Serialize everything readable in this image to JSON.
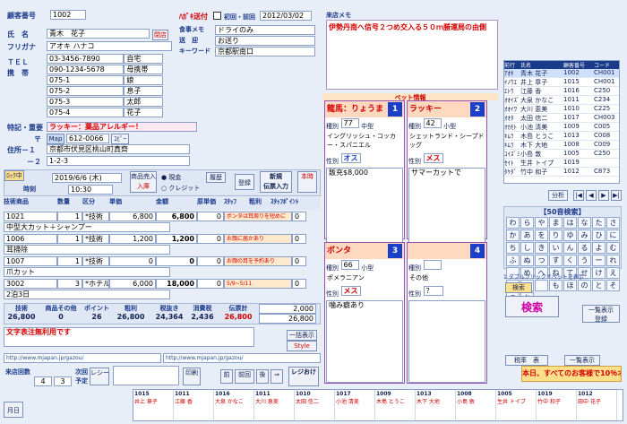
{
  "header": {
    "customer_no_label": "顧客番号",
    "customer_no": "1002",
    "postcard_label": "ﾊｶﾞｷ送付",
    "first_visit_label": "初回・前回",
    "first_visit": "2012/03/02",
    "memo_label": "来店メモ",
    "memo_text": "伊勢丹南へ信号２つめ交入る５０ｍ勝運局の由側"
  },
  "customer": {
    "name_label": "氏　名",
    "name": "青木　花子",
    "kana_label": "フリガナ",
    "kana": "アオキ ハナコ",
    "tel_label": "ＴＥＬ",
    "phones_label": "携　帯",
    "phones": [
      {
        "num": "03-3456-7890",
        "who": "自宅"
      },
      {
        "num": "090-1234-5678",
        "who": "母携帯"
      },
      {
        "num": "075-1",
        "who": "娘"
      },
      {
        "num": "075-2",
        "who": "息子"
      },
      {
        "num": "075-3",
        "who": "太郎"
      },
      {
        "num": "075-4",
        "who": "花子"
      }
    ],
    "food_memo_label": "食事メモ",
    "food_memo": "ドライのみ",
    "pickup_label": "送　迎",
    "pickup": "お送り",
    "keyword_label": "キーワード",
    "keyword": "京都駅南口",
    "note_label": "特記・重要",
    "note": "ラッキー：薬品アレルギー！",
    "zip_label": "〒",
    "zip": "612-0066",
    "map_btn": "Map",
    "copy_btn": "ｺﾋﾟｰ",
    "addr_label": "住所－１",
    "addr1": "京都市伏見区桃山町真齊",
    "addr2_label": "－２",
    "addr2": "1-2-3",
    "shop_badge": "閉店"
  },
  "visit": {
    "lock_label": "ﾛｯｸ中",
    "date": "2019/6/6 (木)",
    "time": "10:30",
    "time_label": "時刻",
    "cash_label": "現金",
    "credit_label": "クレジット",
    "product_label": "商品売入",
    "entry_label": "入庫",
    "history_label": "履歴",
    "new_btn": "新規\n伝票入力",
    "this_time": "本時",
    "register": "登録",
    "unit_label": "単価",
    "amount_label": "金額"
  },
  "lines": {
    "headers": [
      "技術商品",
      "数量",
      "区分",
      "単価",
      "金額",
      "原単価",
      "ｽﾀｯﾌ",
      "粗利",
      "ｽﾀｯﾌﾎﾟｲﾝﾄ"
    ],
    "rows": [
      {
        "code": "1021",
        "name": "中型大カット＋シャンプー",
        "qty": "1",
        "kind": "*技術",
        "unit": "6,800",
        "amt": "6,800",
        "cost": "0",
        "staff": "ボンタは耳周りを短めに",
        "pt": "0"
      },
      {
        "code": "1006",
        "name": "耳掃除",
        "qty": "1",
        "kind": "*技術",
        "unit": "1,200",
        "amt": "1,200",
        "cost": "0",
        "staff": "お顔に届かあり",
        "pt": "0"
      },
      {
        "code": "1007",
        "name": "爪カット",
        "qty": "1",
        "kind": "*技術",
        "unit": "0",
        "amt": "0",
        "cost": "0",
        "staff": "お顔の耳を予約あり",
        "pt": "0"
      },
      {
        "code": "3002",
        "name": "2泊3日",
        "qty": "3",
        "kind": "*ホテル",
        "unit": "6,000",
        "amt": "18,000",
        "cost": "0",
        "staff": "5/9~5/11",
        "pt": "0"
      }
    ]
  },
  "totals": {
    "labels": [
      "技術",
      "商品その他",
      "ポイント",
      "粗利",
      "税抜き",
      "消費税",
      "伝票計"
    ],
    "values": [
      "26,800",
      "0",
      "26",
      "26,800",
      "24,364",
      "2,436",
      "26,800"
    ],
    "received": "2,000",
    "change": "26,800",
    "memo_label": "文字表注無利用です",
    "url1": "http://www.mjapan.jp/gazou/",
    "url2": "http://www.mjapan.jp/gazou/",
    "style_btn": "Style",
    "batch_btn": "一括表示"
  },
  "bottom": {
    "count_label": "来店回数",
    "count": "4",
    "next_label": "次回\n予定",
    "prev_label": "前回",
    "cnt": "3",
    "receipt": "レシート",
    "print": "印刷",
    "ops": [
      "前",
      "前回",
      "後",
      "⇒"
    ],
    "reg_btn": "レジおけ",
    "month": "月日"
  },
  "pets": {
    "title": "ペット情報",
    "cards": [
      {
        "no": "1",
        "name": "龍馬：りょうま",
        "kind_label": "種別",
        "kind": "77",
        "size": "中型",
        "breed": "イングリッシュ・コッカー・スパニエル",
        "sex_label": "性別",
        "sex": "オス",
        "note": "飯充$8,000"
      },
      {
        "no": "2",
        "name": "ラッキー",
        "kind_label": "種別",
        "kind": "42",
        "size": "小型",
        "breed": "シェットランド・シープドッグ",
        "sex_label": "性別",
        "sex": "メス",
        "note": "サマーカットで"
      },
      {
        "no": "3",
        "name": "ボンタ",
        "kind_label": "種別",
        "kind": "66",
        "size": "小型",
        "breed": "ポメラニアン",
        "sex_label": "性別",
        "sex": "メス",
        "note": "噛み癖あり"
      },
      {
        "no": "4",
        "name": "",
        "kind_label": "種別",
        "kind": "",
        "size": "",
        "breed": "その他",
        "sex_label": "性別",
        "sex": "？",
        "note": ""
      }
    ]
  },
  "side": {
    "head": [
      "前行",
      "氏名",
      "顧客番号",
      "コード"
    ],
    "rows": [
      [
        "ｱｵｷ",
        "青木 花子",
        "1002",
        "CH001"
      ],
      [
        "ｲﾉｳｴ",
        "井上 章子",
        "1015",
        "CH001"
      ],
      [
        "ｴﾄｳ",
        "江藤 香",
        "1016",
        "C250"
      ],
      [
        "ｵｵｲｽﾞﾐ",
        "大泉 かなこ",
        "1011",
        "C234"
      ],
      [
        "ｵｵｲﾜ",
        "大川 恵美",
        "1010",
        "C225"
      ],
      [
        "ｵｵﾀ",
        "太田 信二",
        "1017",
        "CH003"
      ],
      [
        "ｵｶﾓﾄ",
        "小池 清美",
        "1009",
        "C005"
      ],
      [
        "ｷﾑﾗ",
        "木島 とうこ",
        "1013",
        "C008"
      ],
      [
        "ｷﾑﾗ",
        "木下 大地",
        "1008",
        "C009"
      ],
      [
        "ｺｲｽﾞﾐ",
        "小島 敦",
        "1005",
        "C250"
      ],
      [
        "ｾｲﾄ",
        "生井 トイプ",
        "1019",
        ""
      ],
      [
        "ﾀｹﾀﾞ",
        "竹中 和子",
        "1012",
        "C873"
      ]
    ],
    "search_title": "【50音検索】",
    "search_btn": "検索",
    "search_label": "検索",
    "all_btn": "一覧表示",
    "confirm": "一覧表示\n登録",
    "table_btn": "税率　表",
    "marquee": "本日、すべてのお客様で10％オフ",
    "analysis": "分析",
    "detail": "1 ダブルクリックでペットを表示",
    "kana": [
      "わ",
      "ら",
      "や",
      "ま",
      "は",
      "な",
      "た",
      "さ",
      "か",
      "あ",
      "を",
      "り",
      "ゆ",
      "み",
      "ひ",
      "に",
      "ち",
      "し",
      "き",
      "い",
      "ん",
      "る",
      "よ",
      "む",
      "ふ",
      "ぬ",
      "つ",
      "す",
      "く",
      "う",
      "ー",
      "れ",
      "",
      "め",
      "へ",
      "ね",
      "て",
      "せ",
      "け",
      "え",
      "",
      "ろ",
      "",
      "も",
      "ほ",
      "の",
      "と",
      "そ",
      "こ",
      "お"
    ]
  },
  "strip": {
    "items": [
      {
        "code": "1015",
        "name": "井上 章子"
      },
      {
        "code": "1011",
        "name": "江藤 香"
      },
      {
        "code": "1016",
        "name": "大泉 かなこ"
      },
      {
        "code": "1011",
        "name": "大川 恵美"
      },
      {
        "code": "1010",
        "name": "太田 信二"
      },
      {
        "code": "1017",
        "name": "小池 清美"
      },
      {
        "code": "1009",
        "name": "木島 とうこ"
      },
      {
        "code": "1013",
        "name": "木下 大地"
      },
      {
        "code": "1008",
        "name": "小島 敦"
      },
      {
        "code": "1005",
        "name": "生井 トイプ"
      },
      {
        "code": "1019",
        "name": "竹中 和子"
      },
      {
        "code": "1012",
        "name": "田中 花子"
      }
    ]
  }
}
